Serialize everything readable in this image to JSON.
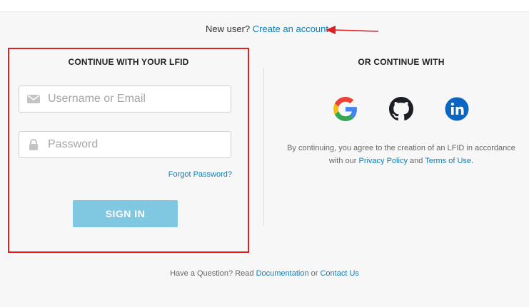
{
  "header": {
    "new_user_text": "New user?",
    "create_account_link": "Create an account"
  },
  "lfid": {
    "title": "CONTINUE WITH YOUR LFID",
    "username_placeholder": "Username or Email",
    "username_value": "",
    "password_placeholder": "Password",
    "password_value": "",
    "forgot_link": "Forgot Password?",
    "signin_label": "SIGN IN"
  },
  "social": {
    "title": "OR CONTINUE WITH",
    "providers": [
      "google-icon",
      "github-icon",
      "linkedin-icon"
    ],
    "agree_text_1": "By continuing, you agree to the creation of an LFID in accordance with our",
    "privacy_link": "Privacy Policy",
    "and_text": "and",
    "terms_link": "Terms of Use."
  },
  "footer": {
    "question_text": "Have a Question? Read",
    "documentation_link": "Documentation",
    "or_text": "or",
    "contact_link": "Contact Us"
  },
  "colors": {
    "link": "#0b7fb5",
    "signin_button": "#80c7e2",
    "highlight": "#e02020",
    "linkedin": "#0a66c2"
  }
}
